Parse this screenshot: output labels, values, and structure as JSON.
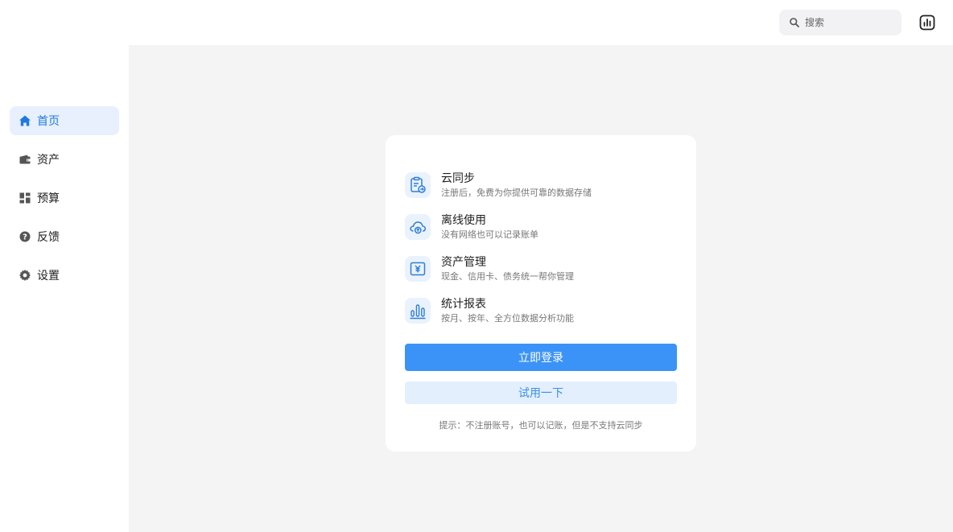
{
  "header": {
    "search": {
      "placeholder": "搜索",
      "icon": "search-icon"
    },
    "stats_button": {
      "icon": "bar-chart-icon"
    }
  },
  "sidebar": {
    "items": [
      {
        "label": "首页",
        "icon": "home-icon",
        "active": true
      },
      {
        "label": "资产",
        "icon": "wallet-icon",
        "active": false
      },
      {
        "label": "预算",
        "icon": "dashboard-icon",
        "active": false
      },
      {
        "label": "反馈",
        "icon": "help-circle-icon",
        "active": false
      },
      {
        "label": "设置",
        "icon": "gear-icon",
        "active": false
      }
    ]
  },
  "card": {
    "features": [
      {
        "title": "云同步",
        "desc": "注册后，免费为你提供可靠的数据存储",
        "icon": "clipboard-sync-icon"
      },
      {
        "title": "离线使用",
        "desc": "没有网络也可以记录账单",
        "icon": "cloud-upload-icon"
      },
      {
        "title": "资产管理",
        "desc": "现金、信用卡、债务统一帮你管理",
        "icon": "yen-icon"
      },
      {
        "title": "统计报表",
        "desc": "按月、按年、全方位数据分析功能",
        "icon": "bar-chart-icon"
      }
    ],
    "login_button": "立即登录",
    "try_button": "试用一下",
    "hint": "提示：不注册账号，也可以记账，但是不支持云同步"
  },
  "colors": {
    "accent": "#3b93f7",
    "accent_light": "#e3effd",
    "active_nav_bg": "#e8f0fd",
    "active_nav_text": "#1f7ae0",
    "main_bg": "#f4f4f4"
  }
}
